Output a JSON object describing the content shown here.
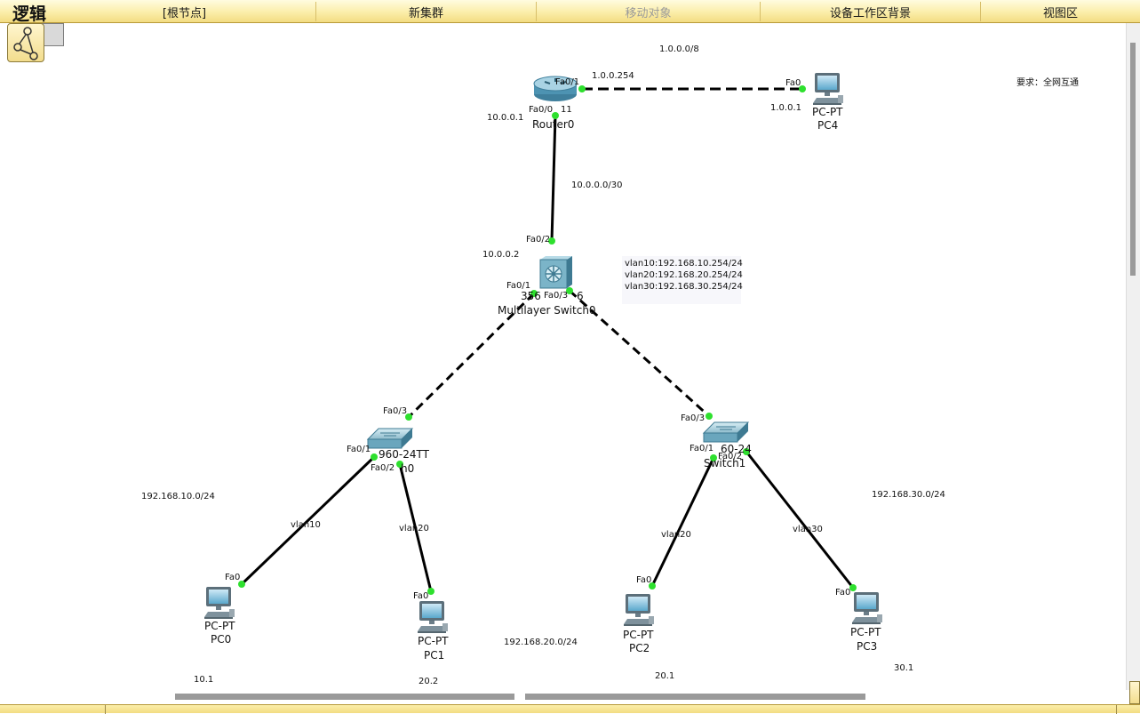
{
  "toolbar": {
    "logic_label": "逻辑",
    "root_node": "[根节点]",
    "new_cluster": "新集群",
    "move_object": "移动对象",
    "set_background": "设备工作区背景",
    "viewport": "视图区"
  },
  "colors": {
    "link": "#000000",
    "port_up": "#2ee02e",
    "toolbar_bg": "#fbeeaa"
  },
  "requirement": "要求：全网互通",
  "networks": {
    "net_pc4": "1.0.0.0/8",
    "net_router_switch": "10.0.0.0/30",
    "net_vlan10": "192.168.10.0/24",
    "net_vlan20": "192.168.20.0/24",
    "net_vlan30": "192.168.30.0/24"
  },
  "vlan_gateways": {
    "vlan10": "vlan10:192.168.10.254/24",
    "vlan20": "vlan20:192.168.20.254/24",
    "vlan30": "vlan30:192.168.30.254/24"
  },
  "devices": {
    "router0": {
      "name": "Router0",
      "port_fa01": "Fa0/1",
      "port_fa00": "Fa0/0",
      "overlay_digits": "11",
      "ip_fa01": "1.0.0.254",
      "ip_fa00": "10.0.0.1",
      "icon": "router-icon"
    },
    "pc4": {
      "type": "PC-PT",
      "name": "PC4",
      "port": "Fa0",
      "ip": "1.0.0.1",
      "icon": "pc-icon"
    },
    "mls0": {
      "model": "356",
      "model_suffix": "6",
      "name": "Multilayer Switch0",
      "port_fa02": "Fa0/2",
      "port_fa01": "Fa0/1",
      "port_fa03": "Fa0/3",
      "ip": "10.0.0.2",
      "icon": "multilayer-switch-icon"
    },
    "switch0": {
      "model": "2960-24TT",
      "model_visible": "960-24TT",
      "name_visible": "h0",
      "port_fa03": "Fa0/3",
      "port_fa01": "Fa0/1",
      "port_fa02": "Fa0/2",
      "icon": "switch-icon"
    },
    "switch1": {
      "model_visible": "60-24",
      "name": "Switch1",
      "port_fa03": "Fa0/3",
      "port_fa01": "Fa0/1",
      "port_fa02": "Fa0/2",
      "icon": "switch-icon"
    },
    "pc0": {
      "type": "PC-PT",
      "name": "PC0",
      "port": "Fa0",
      "ip": "10.1",
      "vlan": "vlan10"
    },
    "pc1": {
      "type": "PC-PT",
      "name": "PC1",
      "port": "Fa0",
      "ip": "20.2",
      "vlan": "vlan20"
    },
    "pc2": {
      "type": "PC-PT",
      "name": "PC2",
      "port": "Fa0",
      "ip": "20.1",
      "vlan": "vlan20"
    },
    "pc3": {
      "type": "PC-PT",
      "name": "PC3",
      "port": "Fa0",
      "ip": "30.1",
      "vlan": "vlan30"
    }
  }
}
